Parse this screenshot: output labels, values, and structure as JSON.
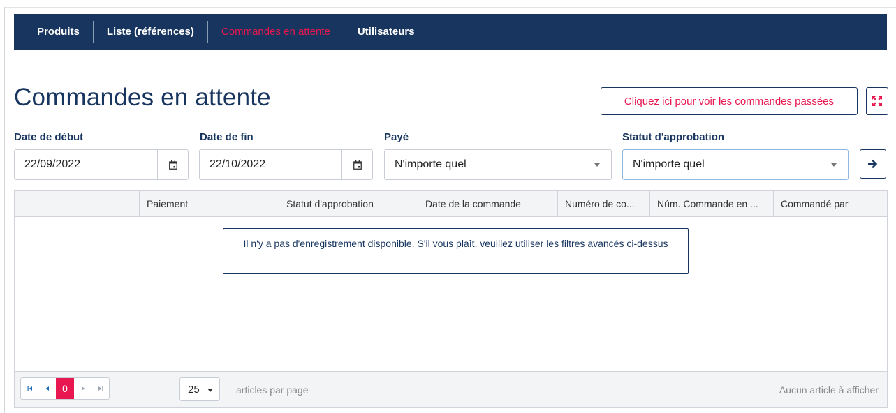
{
  "nav": {
    "items": [
      {
        "label": "Produits"
      },
      {
        "label": "Liste (références)"
      },
      {
        "label": "Commandes en attente"
      },
      {
        "label": "Utilisateurs"
      }
    ]
  },
  "page": {
    "title": "Commandes en attente",
    "past_orders_button": "Cliquez ici pour voir les commandes passées",
    "expand_icon": "expand-icon"
  },
  "filters": {
    "start_date": {
      "label": "Date de début",
      "value": "22/09/2022"
    },
    "end_date": {
      "label": "Date de fin",
      "value": "22/10/2022"
    },
    "paid": {
      "label": "Payé",
      "value": "N'importe quel"
    },
    "approval_status": {
      "label": "Statut d'approbation",
      "value": "N'importe quel"
    },
    "submit_icon": "arrow-right-icon"
  },
  "grid": {
    "columns": [
      "",
      "Paiement",
      "Statut d'approbation",
      "Date de la commande",
      "Numéro de co...",
      "Núm. Commande en ...",
      "Commandé par"
    ],
    "empty_message": "Il n'y a pas d'enregistrement disponible. S'il vous plaît, veuillez utiliser les filtres avancés ci-dessus"
  },
  "pager": {
    "current_page": "0",
    "page_size": "25",
    "per_page_label": "articles par page",
    "no_items_label": "Aucun article à afficher"
  },
  "colors": {
    "nav_bg": "#17355f",
    "accent": "#e8174f",
    "border": "#d0d4da"
  }
}
